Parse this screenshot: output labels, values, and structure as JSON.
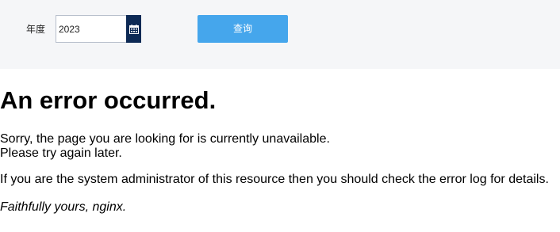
{
  "toolbar": {
    "year_label": "年度",
    "year_value": "2023",
    "query_label": "查询",
    "accent_color": "#45a6ec",
    "calendar_button_color": "#0d2a55",
    "calendar_icon": "calendar-icon"
  },
  "error": {
    "title": "An error occurred.",
    "line1": "Sorry, the page you are looking for is currently unavailable.",
    "line2": "Please try again later.",
    "admin_note": "If you are the system administrator of this resource then you should check the error log for details.",
    "signature": "Faithfully yours, nginx."
  }
}
